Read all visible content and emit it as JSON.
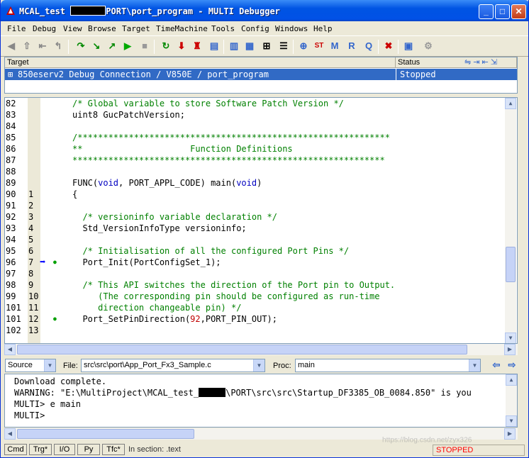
{
  "window": {
    "title_prefix": "MCAL_test",
    "title_suffix": "PORT\\port_program - MULTI Debugger",
    "minimize_glyph": "_",
    "maximize_glyph": "□",
    "close_glyph": "✕"
  },
  "menu": [
    "File",
    "Debug",
    "View",
    "Browse",
    "Target",
    "TimeMachine",
    "Tools",
    "Config",
    "Windows",
    "Help"
  ],
  "toolbar_icons": [
    "back-arrow-icon",
    "up-arrow-icon",
    "step-back-icon",
    "return-icon",
    "step-over-icon",
    "step-into-icon",
    "step-out-icon",
    "run-icon",
    "stop-icon",
    "restart-icon",
    "download-icon",
    "reload-icon",
    "file-icon-1",
    "file-icon-2",
    "add-breakpoint-icon",
    "list-icon",
    "zoom-icon",
    "st-icon",
    "m-icon",
    "r-icon",
    "q-icon",
    "remove-icon",
    "notes-icon",
    "gear-icon"
  ],
  "targets": {
    "col_target": "Target",
    "col_status": "Status",
    "row_target": "850eserv2 Debug Connection / V850E / port_program",
    "row_status": "Stopped",
    "expand_glyph": "⊞"
  },
  "editor": {
    "lines": [
      {
        "n": "82",
        "b": "",
        "code": "/* Global variable to store Software Patch Version */",
        "cls": "cm"
      },
      {
        "n": "83",
        "b": "",
        "code": "uint8 GucPatchVersion;",
        "cls": ""
      },
      {
        "n": "84",
        "b": "",
        "code": "",
        "cls": ""
      },
      {
        "n": "85",
        "b": "",
        "code": "/*************************************************************",
        "cls": "cm"
      },
      {
        "n": "86",
        "b": "",
        "code": "**                     Function Definitions",
        "cls": "cm"
      },
      {
        "n": "87",
        "b": "",
        "code": "*************************************************************",
        "cls": "cm"
      },
      {
        "n": "88",
        "b": "",
        "code": "",
        "cls": ""
      },
      {
        "n": "89",
        "b": "",
        "code": "FUNC(void, PORT_APPL_CODE) main(void)",
        "cls": "func"
      },
      {
        "n": "90",
        "b": "1",
        "code": "{",
        "cls": ""
      },
      {
        "n": "91",
        "b": "2",
        "code": "",
        "cls": ""
      },
      {
        "n": "92",
        "b": "3",
        "code": "  /* versioninfo variable declaration */",
        "cls": "cm"
      },
      {
        "n": "93",
        "b": "4",
        "code": "  Std_VersionInfoType versioninfo;",
        "cls": ""
      },
      {
        "n": "94",
        "b": "5",
        "code": "",
        "cls": ""
      },
      {
        "n": "95",
        "b": "6",
        "code": "  /* Initialisation of all the configured Port Pins */",
        "cls": "cm"
      },
      {
        "n": "96",
        "b": "7",
        "code": "  Port_Init(PortConfigSet_1);",
        "cls": ""
      },
      {
        "n": "97",
        "b": "8",
        "code": "",
        "cls": ""
      },
      {
        "n": "98",
        "b": "9",
        "code": "  /* This API switches the direction of the Port pin to Output.",
        "cls": "cm"
      },
      {
        "n": "99",
        "b": "10",
        "code": "     (The corresponding pin should be configured as run-time",
        "cls": "cm"
      },
      {
        "n": "101",
        "b": "11",
        "code": "     direction changeable pin) */",
        "cls": "cm"
      },
      {
        "n": "101",
        "b": "12",
        "code": "  Port_SetPinDirection(92,PORT_PIN_OUT);",
        "cls": "setpin"
      },
      {
        "n": "102",
        "b": "13",
        "code": "",
        "cls": ""
      }
    ]
  },
  "source_bar": {
    "view_select": "Source",
    "file_label": "File:",
    "file_value": "src\\src\\port\\App_Port_Fx3_Sample.c",
    "proc_label": "Proc:",
    "proc_value": "main"
  },
  "console": {
    "line1": "Download complete.",
    "line2a": "WARNING: \"E:\\MultiProject\\MCAL_test_",
    "line2b": "\\PORT\\src\\src\\Startup_DF3385_OB_0084.850\" is you",
    "line3": "MULTI> e main",
    "line4": "MULTI>"
  },
  "status": {
    "tabs": [
      "Cmd",
      "Trg*",
      "I/O",
      "Py",
      "Tfc*"
    ],
    "section": "In section: .text",
    "state": "STOPPED",
    "watermark": "https://blog.csdn.net/zyx326"
  },
  "colors": {
    "selection": "#316ac5",
    "stopped": "#ff0000",
    "comment": "#008000",
    "keyword": "#0000c0",
    "number": "#c00000",
    "pc_arrow": "#0000ff",
    "bp_dot": "#00a000"
  }
}
